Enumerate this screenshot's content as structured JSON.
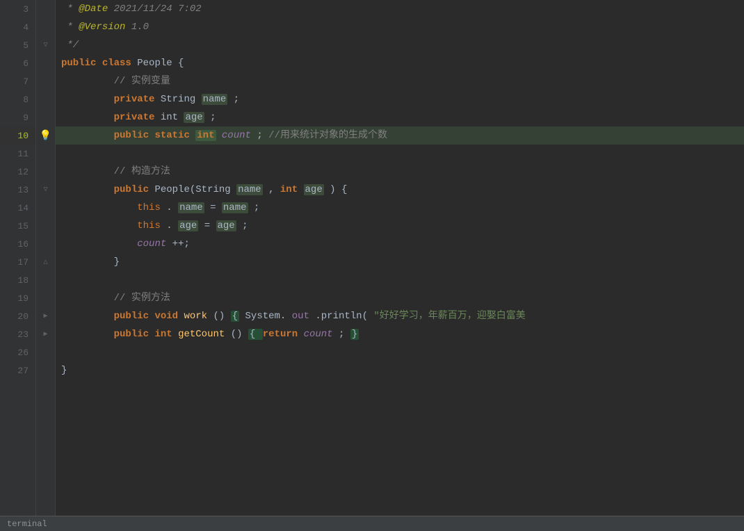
{
  "editor": {
    "lines": [
      {
        "num": 3,
        "gutter": "",
        "content": "line3",
        "highlighted": false
      },
      {
        "num": 4,
        "gutter": "",
        "content": "line4",
        "highlighted": false
      },
      {
        "num": 5,
        "gutter": "fold-close",
        "content": "line5",
        "highlighted": false
      },
      {
        "num": 6,
        "gutter": "",
        "content": "line6",
        "highlighted": false
      },
      {
        "num": 7,
        "gutter": "",
        "content": "line7",
        "highlighted": false
      },
      {
        "num": 8,
        "gutter": "",
        "content": "line8",
        "highlighted": false
      },
      {
        "num": 9,
        "gutter": "",
        "content": "line9",
        "highlighted": false
      },
      {
        "num": 10,
        "gutter": "bulb",
        "content": "line10",
        "highlighted": true
      },
      {
        "num": 11,
        "gutter": "",
        "content": "line11",
        "highlighted": false
      },
      {
        "num": 12,
        "gutter": "",
        "content": "line12",
        "highlighted": false
      },
      {
        "num": 13,
        "gutter": "fold-open",
        "content": "line13",
        "highlighted": false
      },
      {
        "num": 14,
        "gutter": "",
        "content": "line14",
        "highlighted": false
      },
      {
        "num": 15,
        "gutter": "",
        "content": "line15",
        "highlighted": false
      },
      {
        "num": 16,
        "gutter": "",
        "content": "line16",
        "highlighted": false
      },
      {
        "num": 17,
        "gutter": "fold-close2",
        "content": "line17",
        "highlighted": false
      },
      {
        "num": 18,
        "gutter": "",
        "content": "line18",
        "highlighted": false
      },
      {
        "num": 19,
        "gutter": "",
        "content": "line19",
        "highlighted": false
      },
      {
        "num": 20,
        "gutter": "fold-collapsed",
        "content": "line20",
        "highlighted": false
      },
      {
        "num": 23,
        "gutter": "fold-collapsed2",
        "content": "line23",
        "highlighted": false
      },
      {
        "num": 26,
        "gutter": "",
        "content": "line26",
        "highlighted": false
      },
      {
        "num": 27,
        "gutter": "",
        "content": "line27",
        "highlighted": false
      }
    ],
    "terminal_label": "terminal"
  }
}
